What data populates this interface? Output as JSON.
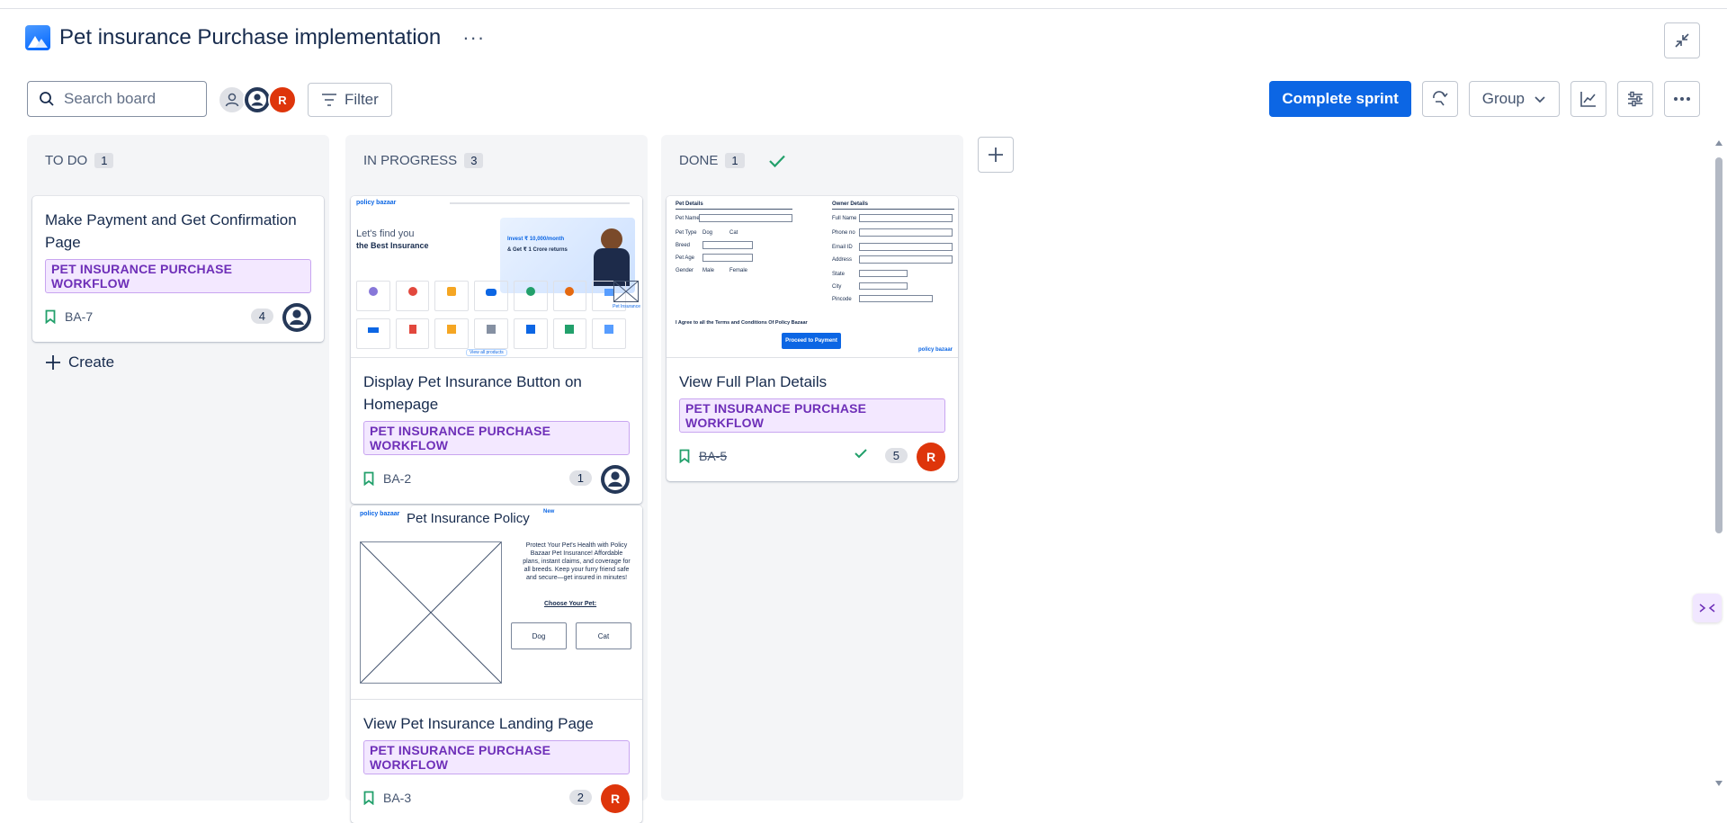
{
  "header": {
    "project_icon": "project-image-icon",
    "title": "Pet insurance Purchase implementation",
    "more_label": "···"
  },
  "toolbar": {
    "search_placeholder": "Search board",
    "avatars": [
      {
        "type": "unassigned",
        "initial": ""
      },
      {
        "type": "user",
        "initial": ""
      },
      {
        "type": "user",
        "initial": "R"
      }
    ],
    "filter_label": "Filter",
    "complete_sprint_label": "Complete sprint",
    "group_label": "Group"
  },
  "columns": [
    {
      "name": "TO DO",
      "count": "1"
    },
    {
      "name": "IN PROGRESS",
      "count": "3"
    },
    {
      "name": "DONE",
      "count": "1"
    }
  ],
  "cards": {
    "ba7": {
      "title": "Make Payment and Get Confirmation Page",
      "label": "PET INSURANCE PURCHASE WORKFLOW",
      "key": "BA-7",
      "points": "4"
    },
    "ba2": {
      "title": "Display Pet Insurance Button on Homepage",
      "label": "PET INSURANCE PURCHASE WORKFLOW",
      "key": "BA-2",
      "points": "1"
    },
    "ba3": {
      "title": "View Pet Insurance Landing Page",
      "label": "PET INSURANCE PURCHASE WORKFLOW",
      "key": "BA-3",
      "points": "2",
      "assignee": "R"
    },
    "ba5": {
      "title": "View Full Plan Details",
      "label": "PET INSURANCE PURCHASE WORKFLOW",
      "key": "BA-5",
      "points": "5",
      "assignee": "R"
    }
  },
  "create_label": "Create",
  "thumbs": {
    "homepage": {
      "brand": "policy bazaar",
      "headline_1": "Let's find you",
      "headline_2": "the Best Insurance",
      "promo_1": "Invest ₹ 10,000/month",
      "promo_2": "& Get ₹ 1 Crore returns",
      "tile_label": "Pet Insurance",
      "view_all": "View all products"
    },
    "landing": {
      "brand": "policy bazaar",
      "title": "Pet Insurance Policy",
      "new_badge": "New",
      "description": "Protect Your Pet's Health with Policy Bazaar Pet Insurance! Affordable plans, instant claims, and coverage for all breeds. Keep your furry friend safe and secure—get insured in minutes!",
      "choose": "Choose Your Pet:",
      "dog": "Dog",
      "cat": "Cat"
    },
    "form": {
      "pet_details": "Pet Details",
      "owner_details": "Owner Details",
      "pet_fields": [
        "Pet Name",
        "Pet Type",
        "Breed",
        "Pet Age",
        "Gender"
      ],
      "owner_fields": [
        "Full Name",
        "Phone no",
        "Email ID",
        "Address",
        "State",
        "City",
        "Pincode"
      ],
      "dog": "Dog",
      "cat": "Cat",
      "male": "Male",
      "female": "Female",
      "agree": "I Agree to all the Terms and Conditions Of Policy Bazaar",
      "proceed": "Proceed to Payment",
      "brand": "policy bazaar"
    }
  },
  "colors": {
    "primary": "#0c66e4",
    "lozenge_bg": "#f3e8ff",
    "lozenge_text": "#6e2fb8",
    "done_green": "#22a06b"
  }
}
